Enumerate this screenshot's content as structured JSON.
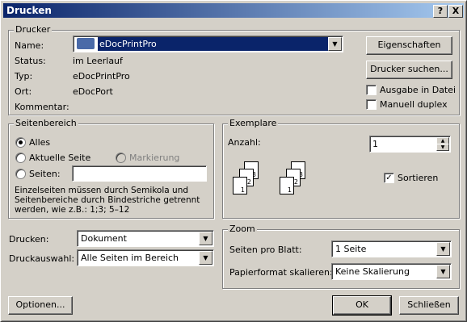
{
  "window": {
    "title": "Drucken"
  },
  "titlebar": {
    "help": "?",
    "close": "X"
  },
  "printer": {
    "legend": "Drucker",
    "name_label": "Name:",
    "name_value": "eDocPrintPro",
    "status_label": "Status:",
    "status_value": "im Leerlauf",
    "type_label": "Typ:",
    "type_value": "eDocPrintPro",
    "location_label": "Ort:",
    "location_value": "eDocPort",
    "comment_label": "Kommentar:",
    "properties_button": "Eigenschaften",
    "find_button": "Drucker suchen...",
    "print_to_file": "Ausgabe in Datei",
    "manual_duplex": "Manuell duplex"
  },
  "page_range": {
    "legend": "Seitenbereich",
    "all": "Alles",
    "current": "Aktuelle Seite",
    "selection": "Markierung",
    "pages": "Seiten:",
    "hint": "Einzelseiten müssen durch Semikola und Seitenbereiche durch Bindestriche getrennt werden, wie z.B.: 1;3; 5–12"
  },
  "copies": {
    "legend": "Exemplare",
    "count_label": "Anzahl:",
    "count_value": "1",
    "collate": "Sortieren",
    "page_labels": [
      "3",
      "2",
      "1",
      "3",
      "2",
      "1"
    ]
  },
  "print_what": {
    "label": "Drucken:",
    "value": "Dokument"
  },
  "print_sel": {
    "label": "Druckauswahl:",
    "value": "Alle Seiten im Bereich"
  },
  "zoom": {
    "legend": "Zoom",
    "pps_label": "Seiten pro Blatt:",
    "pps_value": "1 Seite",
    "scale_label": "Papierformat skalieren:",
    "scale_value": "Keine Skalierung"
  },
  "footer": {
    "options": "Optionen...",
    "ok": "OK",
    "close": "Schließen"
  }
}
